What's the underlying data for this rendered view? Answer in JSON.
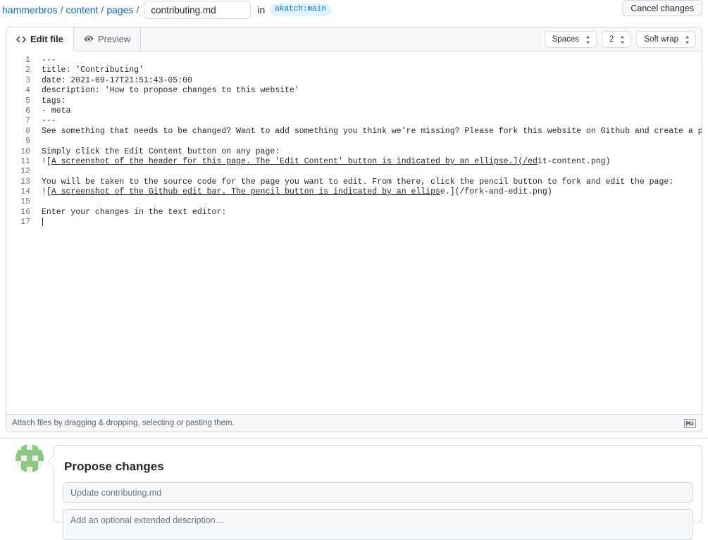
{
  "breadcrumb": {
    "owner": "hammerbros",
    "sep": "/",
    "folder1": "content",
    "folder2": "pages",
    "filename_value": "contributing.md",
    "in_label": "in",
    "branch": "akatch:main"
  },
  "header": {
    "cancel_label": "Cancel changes"
  },
  "tabs": {
    "edit_label": "Edit file",
    "preview_label": "Preview"
  },
  "toolbar": {
    "indent_mode": "Spaces",
    "indent_size": "2",
    "wrap_mode": "Soft wrap"
  },
  "editor": {
    "lines": [
      {
        "n": "1",
        "text": "---"
      },
      {
        "n": "2",
        "text": "title: 'Contributing'"
      },
      {
        "n": "3",
        "text": "date: 2021-09-17T21:51:43-05:00"
      },
      {
        "n": "4",
        "text": "description: 'How to propose changes to this website'"
      },
      {
        "n": "5",
        "text": "tags:"
      },
      {
        "n": "6",
        "text": "- meta"
      },
      {
        "n": "7",
        "text": "---"
      },
      {
        "n": "8",
        "text": "See something that needs to be changed? Want to add something you think we're missing? Please fork this website on Github and create a pull request with your changes!"
      },
      {
        "n": "9",
        "text": ""
      },
      {
        "n": "10",
        "text": "Simply click the Edit Content button on any page:"
      },
      {
        "n": "11",
        "text": "![A screenshot of the header for this page. The 'Edit Content' button is indicated by an ellipse.](/edit-content.png)",
        "link_start": 2,
        "link_end": 102
      },
      {
        "n": "12",
        "text": ""
      },
      {
        "n": "13",
        "text": "You will be taken to the source code for the page you want to edit. From there, click the pencil button to fork and edit the page:"
      },
      {
        "n": "14",
        "text": "![A screenshot of the Github edit bar. The pencil button is indicated by an ellipse.](/fork-and-edit.png)",
        "link_start": 2,
        "link_end": 82
      },
      {
        "n": "15",
        "text": ""
      },
      {
        "n": "16",
        "text": "Enter your changes in the text editor:"
      },
      {
        "n": "17",
        "text": "",
        "caret": true
      }
    ]
  },
  "attach": {
    "hint": "Attach files by dragging & dropping, selecting or pasting them.",
    "markdown_badge": "M↓"
  },
  "propose": {
    "title": "Propose changes",
    "commit_placeholder": "Update contributing.md",
    "description_placeholder": "Add an optional extended description…"
  },
  "colors": {
    "link": "#0969da",
    "branch_bg": "#ddf4ff",
    "border": "#d0d7de",
    "muted_bg": "#f6f8fa",
    "text": "#24292f",
    "muted_text": "#57606a",
    "identicon": "#8ac97f"
  }
}
